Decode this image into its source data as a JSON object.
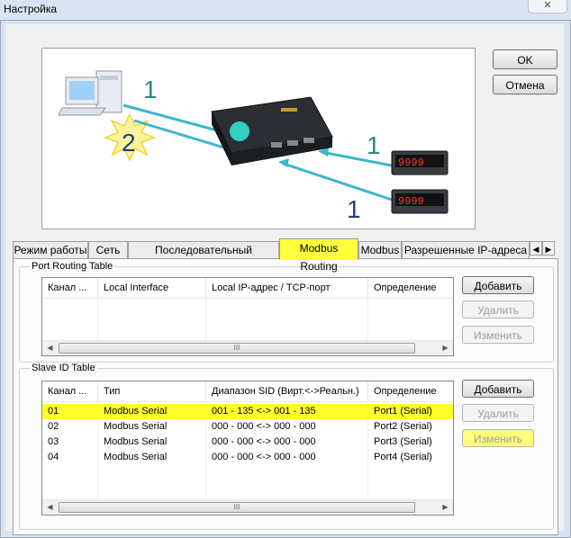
{
  "window": {
    "title": "Настройка",
    "close_glyph": "✕"
  },
  "buttons": {
    "ok": "OK",
    "cancel": "Отмена"
  },
  "diagram": {
    "label_1a": "1",
    "label_2": "2",
    "label_1b": "1",
    "label_1c": "1",
    "meter_digits": "9999"
  },
  "tabs": [
    {
      "label": "Режим работы"
    },
    {
      "label": "Сеть"
    },
    {
      "label": "Последовательный интерфейс"
    },
    {
      "label": "Modbus Routing",
      "active": true
    },
    {
      "label": "Modbus"
    },
    {
      "label": "Разрешенные IP-адреса"
    }
  ],
  "port_routing": {
    "title": "Port Routing Table",
    "columns": [
      "Канал ...",
      "Local Interface",
      "Local IP-адрес / TCP-порт",
      "Определение"
    ],
    "rows": [],
    "buttons": {
      "add": "Добавить",
      "remove": "Удалить",
      "edit": "Изменить"
    }
  },
  "slave_id": {
    "title": "Slave ID Table",
    "columns": [
      "Канал ...",
      "Тип",
      "Диапазон SID (Вирт.<->Реальн.)",
      "Определение"
    ],
    "rows": [
      {
        "channel": "01",
        "type": "Modbus Serial",
        "range": "001 - 135 <-> 001 - 135",
        "def": "Port1 (Serial)",
        "highlighted": true
      },
      {
        "channel": "02",
        "type": "Modbus Serial",
        "range": "000 - 000 <-> 000 - 000",
        "def": "Port2 (Serial)"
      },
      {
        "channel": "03",
        "type": "Modbus Serial",
        "range": "000 - 000 <-> 000 - 000",
        "def": "Port3 (Serial)"
      },
      {
        "channel": "04",
        "type": "Modbus Serial",
        "range": "000 - 000 <-> 000 - 000",
        "def": "Port4 (Serial)"
      }
    ],
    "buttons": {
      "add": "Добавить",
      "remove": "Удалить",
      "edit": "Изменить"
    }
  },
  "scrollbar": {
    "left_arrow": "◀",
    "right_arrow": "▶",
    "grip": "III"
  },
  "colors": {
    "highlight": "#ffff2a",
    "diagram_cable": "#3db6cc",
    "label_teal": "#2a8a7a",
    "label_navy": "#1f3f8a"
  }
}
